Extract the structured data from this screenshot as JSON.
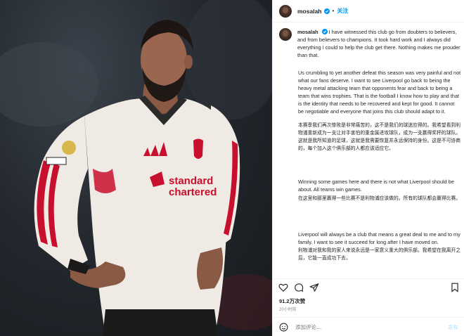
{
  "post": {
    "username": "mosalah",
    "follow_sep": "•",
    "follow_label": "关注",
    "caption_p1": "I have witnessed this club go from doubters to believers, and from believers to champions. It took hard work and I always did everything I could to help the club get there. Nothing makes me prouder than that.",
    "caption_p2": "Us crumbling to yet another defeat this season was very painful and not what our fans deserve. I want to see Liverpool go back to being the heavy metal attacking team that opponents fear and back to being a team that wins trophies. That is the football I know how to play and that is the identity that needs to be recovered and kept for good. It cannot be negotiable and everyone that joins this club should adapt to it.",
    "caption_p2_zh": "本赛季我们再次惨败是非常痛苦的，这不是我们的球迷应得的。我希望看到利物浦重新成为一支让对手害怕的重金属进攻球队，成为一支赢得奖杯的球队。这就是我所知道的足球，这就是我需要恢复并永远保持的身份。这是不可协商的，每个加入这个俱乐部的人都应该适应它。",
    "caption_p3": "Winning some games here and there is not what Liverpool should be about. All teams win games.",
    "caption_p3_zh": "在这里和那里赢得一些比赛不是利物浦应该做的。所有的球队都会赢得比赛。",
    "caption_p4": "Liverpool will always be a club that means a great deal to me and to my family. I want to see it succeed for long after I have moved on.",
    "caption_p4_zh": "利物浦对我和我的家人来说永远是一家意义重大的俱乐部。我希望在我离开之后，它能一直成功下去。",
    "likes": "91.2万次赞",
    "time": "20小时前",
    "comment_placeholder": "添加评论...",
    "post_label": "发布"
  },
  "colors": {
    "accent": "#0095f6",
    "verified": "#0095f6",
    "text": "#262626",
    "muted": "#8e8e8e",
    "jersey": "#efeae4",
    "jersey_trim": "#c8102e"
  },
  "icons": [
    "verified-badge-icon",
    "heart-icon",
    "comment-icon",
    "share-icon",
    "bookmark-icon",
    "emoji-icon"
  ]
}
